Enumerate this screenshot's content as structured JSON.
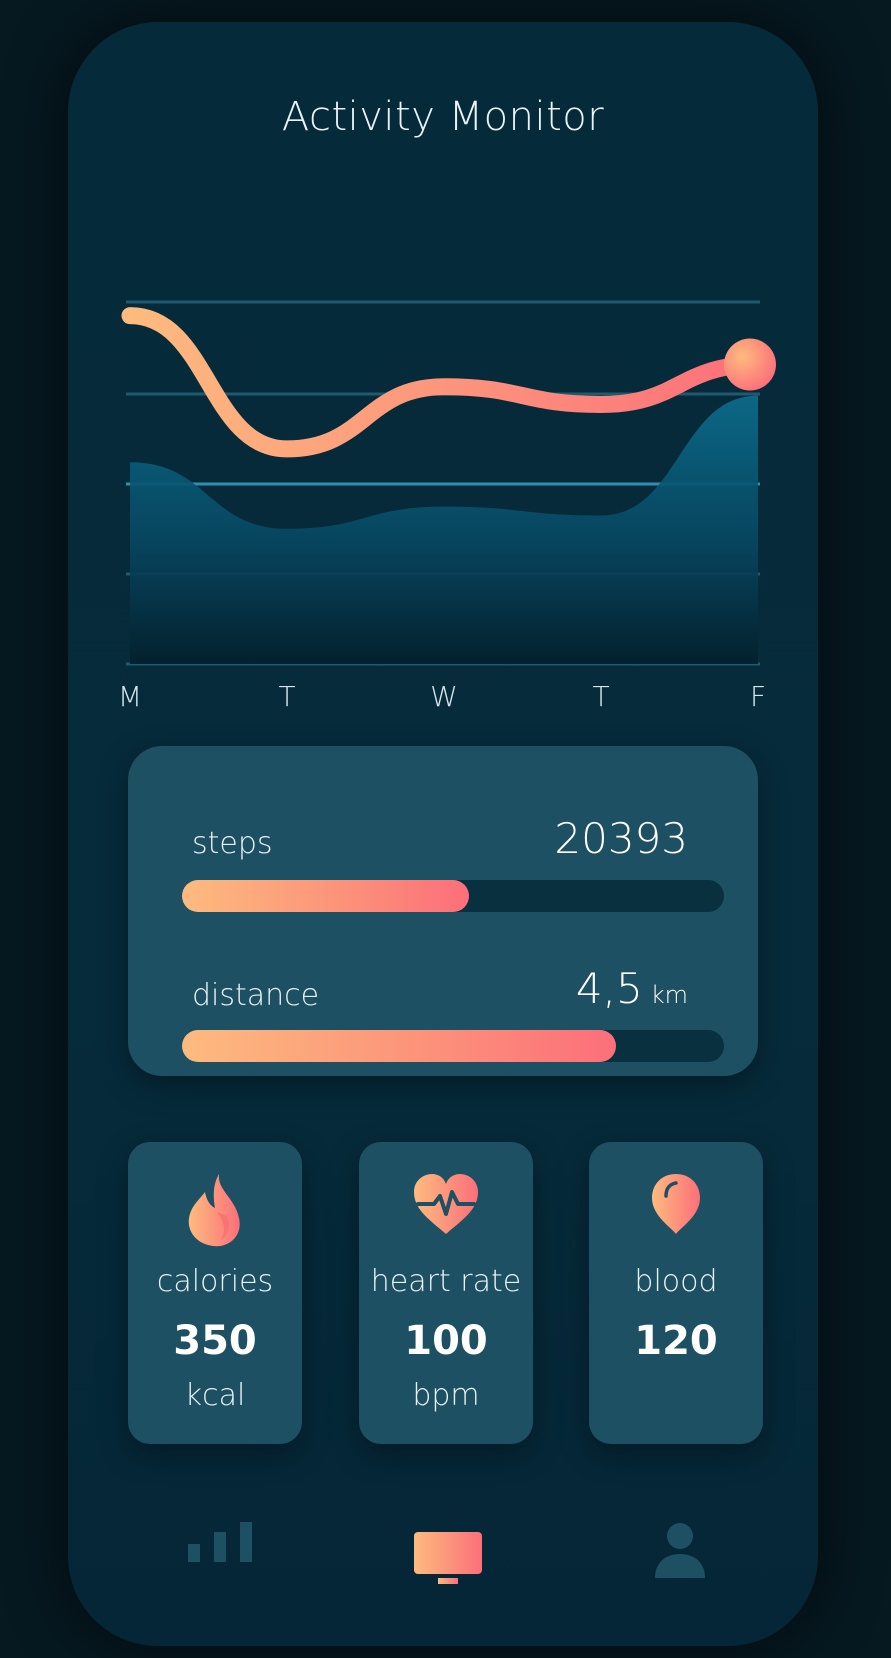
{
  "app": {
    "title": "Activity Monitor"
  },
  "colors": {
    "background": "#061820",
    "card": "#1c5062",
    "accent_start": "#fdbb7e",
    "accent_end": "#fc6f7a",
    "area_fill": "#0b5a76"
  },
  "chart_data": {
    "type": "line",
    "categories": [
      "M",
      "T",
      "W",
      "T",
      "F"
    ],
    "grid": true,
    "gridlines": 5,
    "series": [
      {
        "values": [
          78,
          48,
          62,
          58,
          67
        ]
      },
      {
        "values": [
          45,
          30,
          35,
          33,
          60
        ]
      }
    ]
  },
  "stats": {
    "steps": {
      "label": "steps",
      "value": "20393",
      "progress": 0.53
    },
    "distance": {
      "label": "distance",
      "value": "4,5",
      "unit": "km",
      "progress": 0.8
    }
  },
  "tiles": [
    {
      "label": "calories",
      "value": "350",
      "unit": "kcal",
      "icon": "flame-icon"
    },
    {
      "label": "heart rate",
      "value": "100",
      "unit": "bpm",
      "icon": "heart-pulse-icon"
    },
    {
      "label": "blood",
      "value": "120",
      "unit": "",
      "icon": "blood-drop-icon"
    }
  ],
  "nav": [
    {
      "icon": "bar-chart-icon",
      "active": false
    },
    {
      "icon": "monitor-icon",
      "active": true
    },
    {
      "icon": "user-icon",
      "active": false
    }
  ]
}
